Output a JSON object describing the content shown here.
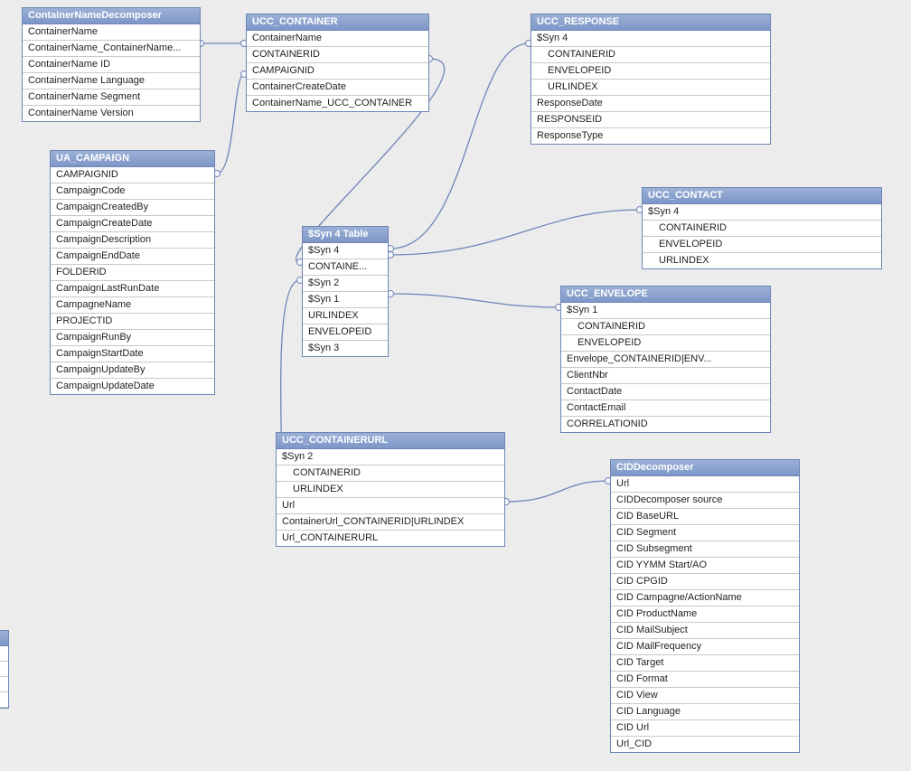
{
  "entities": {
    "containerNameDecomposer": {
      "title": "ContainerNameDecomposer",
      "fields": [
        {
          "label": "ContainerName",
          "indent": false
        },
        {
          "label": "ContainerName_ContainerName...",
          "indent": false
        },
        {
          "label": "ContainerName ID",
          "indent": false
        },
        {
          "label": "ContainerName Language",
          "indent": false
        },
        {
          "label": "ContainerName Segment",
          "indent": false
        },
        {
          "label": "ContainerName Version",
          "indent": false
        }
      ]
    },
    "uccContainer": {
      "title": "UCC_CONTAINER",
      "fields": [
        {
          "label": "ContainerName",
          "indent": false
        },
        {
          "label": "CONTAINERID",
          "indent": false
        },
        {
          "label": "CAMPAIGNID",
          "indent": false
        },
        {
          "label": "ContainerCreateDate",
          "indent": false
        },
        {
          "label": "ContainerName_UCC_CONTAINER",
          "indent": false
        }
      ]
    },
    "uccResponse": {
      "title": "UCC_RESPONSE",
      "fields": [
        {
          "label": "$Syn 4",
          "indent": false
        },
        {
          "label": "CONTAINERID",
          "indent": true
        },
        {
          "label": "ENVELOPEID",
          "indent": true
        },
        {
          "label": "URLINDEX",
          "indent": true
        },
        {
          "label": "ResponseDate",
          "indent": false
        },
        {
          "label": "RESPONSEID",
          "indent": false
        },
        {
          "label": "ResponseType",
          "indent": false
        }
      ]
    },
    "uaCampaign": {
      "title": "UA_CAMPAIGN",
      "fields": [
        {
          "label": "CAMPAIGNID",
          "indent": false
        },
        {
          "label": "CampaignCode",
          "indent": false
        },
        {
          "label": "CampaignCreatedBy",
          "indent": false
        },
        {
          "label": "CampaignCreateDate",
          "indent": false
        },
        {
          "label": "CampaignDescription",
          "indent": false
        },
        {
          "label": "CampaignEndDate",
          "indent": false
        },
        {
          "label": "FOLDERID",
          "indent": false
        },
        {
          "label": "CampaignLastRunDate",
          "indent": false
        },
        {
          "label": "CampagneName",
          "indent": false
        },
        {
          "label": "PROJECTID",
          "indent": false
        },
        {
          "label": "CampaignRunBy",
          "indent": false
        },
        {
          "label": "CampaignStartDate",
          "indent": false
        },
        {
          "label": "CampaignUpdateBy",
          "indent": false
        },
        {
          "label": "CampaignUpdateDate",
          "indent": false
        }
      ]
    },
    "syn4Table": {
      "title": "$Syn 4 Table",
      "fields": [
        {
          "label": "$Syn 4",
          "indent": false
        },
        {
          "label": "CONTAINE...",
          "indent": false
        },
        {
          "label": "$Syn 2",
          "indent": false
        },
        {
          "label": "$Syn 1",
          "indent": false
        },
        {
          "label": "URLINDEX",
          "indent": false
        },
        {
          "label": "ENVELOPEID",
          "indent": false
        },
        {
          "label": "$Syn 3",
          "indent": false
        }
      ]
    },
    "uccContact": {
      "title": "UCC_CONTACT",
      "fields": [
        {
          "label": "$Syn 4",
          "indent": false
        },
        {
          "label": "CONTAINERID",
          "indent": true
        },
        {
          "label": "ENVELOPEID",
          "indent": true
        },
        {
          "label": "URLINDEX",
          "indent": true
        }
      ]
    },
    "uccEnvelope": {
      "title": "UCC_ENVELOPE",
      "fields": [
        {
          "label": "$Syn 1",
          "indent": false
        },
        {
          "label": "CONTAINERID",
          "indent": true
        },
        {
          "label": "ENVELOPEID",
          "indent": true
        },
        {
          "label": "Envelope_CONTAINERID|ENV...",
          "indent": false
        },
        {
          "label": "ClientNbr",
          "indent": false
        },
        {
          "label": "ContactDate",
          "indent": false
        },
        {
          "label": "ContactEmail",
          "indent": false
        },
        {
          "label": "CORRELATIONID",
          "indent": false
        }
      ]
    },
    "uccContainerUrl": {
      "title": "UCC_CONTAINERURL",
      "fields": [
        {
          "label": "$Syn 2",
          "indent": false
        },
        {
          "label": "CONTAINERID",
          "indent": true
        },
        {
          "label": "URLINDEX",
          "indent": true
        },
        {
          "label": "Url",
          "indent": false
        },
        {
          "label": "ContainerUrl_CONTAINERID|URLINDEX",
          "indent": false
        },
        {
          "label": "Url_CONTAINERURL",
          "indent": false
        }
      ]
    },
    "cidDecomposer": {
      "title": "CIDDecomposer",
      "fields": [
        {
          "label": "Url",
          "indent": false
        },
        {
          "label": "CIDDecomposer source",
          "indent": false
        },
        {
          "label": "CID BaseURL",
          "indent": false
        },
        {
          "label": "CID Segment",
          "indent": false
        },
        {
          "label": "CID Subsegment",
          "indent": false
        },
        {
          "label": "CID YYMM Start/AO",
          "indent": false
        },
        {
          "label": "CID CPGID",
          "indent": false
        },
        {
          "label": "CID Campagne/ActionName",
          "indent": false
        },
        {
          "label": "CID ProductName",
          "indent": false
        },
        {
          "label": "CID MailSubject",
          "indent": false
        },
        {
          "label": "CID MailFrequency",
          "indent": false
        },
        {
          "label": "CID Target",
          "indent": false
        },
        {
          "label": "CID Format",
          "indent": false
        },
        {
          "label": "CID View",
          "indent": false
        },
        {
          "label": "CID Language",
          "indent": false
        },
        {
          "label": "CID Url",
          "indent": false
        },
        {
          "label": "Url_CID",
          "indent": false
        }
      ]
    }
  },
  "connections": [
    {
      "from": "containerNameDecomposer",
      "to": "uccContainer",
      "fromSide": "right",
      "toSide": "left"
    },
    {
      "from": "uaCampaign",
      "to": "uccContainer",
      "fromSide": "right",
      "toSide": "left"
    },
    {
      "from": "uccContainer",
      "to": "syn4Table",
      "fromSide": "right",
      "toSide": "left"
    },
    {
      "from": "syn4Table",
      "to": "uccResponse",
      "fromSide": "right",
      "toSide": "left"
    },
    {
      "from": "syn4Table",
      "to": "uccContact",
      "fromSide": "right",
      "toSide": "left"
    },
    {
      "from": "syn4Table",
      "to": "uccEnvelope",
      "fromSide": "right",
      "toSide": "left"
    },
    {
      "from": "syn4Table",
      "to": "uccContainerUrl",
      "fromSide": "left",
      "toSide": "top"
    },
    {
      "from": "uccContainerUrl",
      "to": "cidDecomposer",
      "fromSide": "right",
      "toSide": "left"
    }
  ]
}
